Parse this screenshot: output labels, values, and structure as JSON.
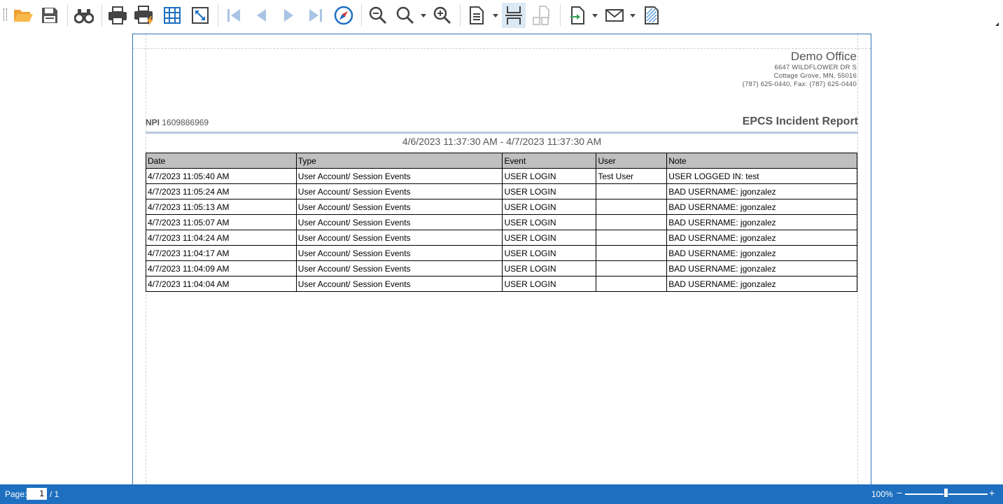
{
  "toolbar": {
    "buttons": [
      {
        "icon": "open-folder-icon"
      },
      {
        "icon": "save-icon"
      },
      {
        "icon": "find-icon"
      },
      {
        "icon": "print-icon"
      },
      {
        "icon": "quick-print-icon"
      },
      {
        "icon": "page-setup-icon"
      },
      {
        "icon": "fit-page-icon"
      },
      {
        "icon": "first-page-icon"
      },
      {
        "icon": "previous-page-icon"
      },
      {
        "icon": "next-page-icon"
      },
      {
        "icon": "last-page-icon"
      },
      {
        "icon": "navigate-icon"
      },
      {
        "icon": "zoom-out-icon"
      },
      {
        "icon": "zoom-icon"
      },
      {
        "icon": "zoom-in-icon"
      },
      {
        "icon": "single-page-icon"
      },
      {
        "icon": "continuous-page-icon"
      },
      {
        "icon": "multi-page-icon"
      },
      {
        "icon": "export-icon"
      },
      {
        "icon": "email-icon"
      },
      {
        "icon": "watermark-icon"
      }
    ],
    "accent": "#1e6fbf",
    "icon_color": "#444444",
    "disabled_color": "#a9c4e4"
  },
  "report": {
    "company": {
      "name": "Demo Office",
      "address": "6647 WILDFLOWER DR S",
      "city": "Cottage Grove, MN, 55016",
      "phone": "(787) 625-0440, Fax: (787) 625-0440"
    },
    "npi_label": "NPI",
    "npi_value": "1609886969",
    "title": "EPCS Incident Report",
    "date_range": "4/6/2023 11:37:30 AM - 4/7/2023 11:37:30 AM",
    "columns": [
      "Date",
      "Type",
      "Event",
      "User",
      "Note"
    ],
    "rows": [
      {
        "date": "4/7/2023 11:05:40 AM",
        "type": "User Account/ Session Events",
        "event": "USER LOGIN",
        "user": "Test User",
        "note": "USER LOGGED IN: test"
      },
      {
        "date": "4/7/2023 11:05:24 AM",
        "type": "User Account/ Session Events",
        "event": "USER LOGIN",
        "user": "",
        "note": "BAD USERNAME: jgonzalez"
      },
      {
        "date": "4/7/2023 11:05:13 AM",
        "type": "User Account/ Session Events",
        "event": "USER LOGIN",
        "user": "",
        "note": "BAD USERNAME: jgonzalez"
      },
      {
        "date": "4/7/2023 11:05:07 AM",
        "type": "User Account/ Session Events",
        "event": "USER LOGIN",
        "user": "",
        "note": "BAD USERNAME: jgonzalez"
      },
      {
        "date": "4/7/2023 11:04:24 AM",
        "type": "User Account/ Session Events",
        "event": "USER LOGIN",
        "user": "",
        "note": "BAD USERNAME: jgonzalez"
      },
      {
        "date": "4/7/2023 11:04:17 AM",
        "type": "User Account/ Session Events",
        "event": "USER LOGIN",
        "user": "",
        "note": "BAD USERNAME: jgonzalez"
      },
      {
        "date": "4/7/2023 11:04:09 AM",
        "type": "User Account/ Session Events",
        "event": "USER LOGIN",
        "user": "",
        "note": "BAD USERNAME: jgonzalez"
      },
      {
        "date": "4/7/2023 11:04:04 AM",
        "type": "User Account/ Session Events",
        "event": "USER LOGIN",
        "user": "",
        "note": "BAD USERNAME: jgonzalez"
      }
    ]
  },
  "statusbar": {
    "page_label": "Page:",
    "page_current": "1",
    "page_total": "/ 1",
    "zoom": "100%",
    "zoom_minus": "−",
    "zoom_plus": "+"
  }
}
